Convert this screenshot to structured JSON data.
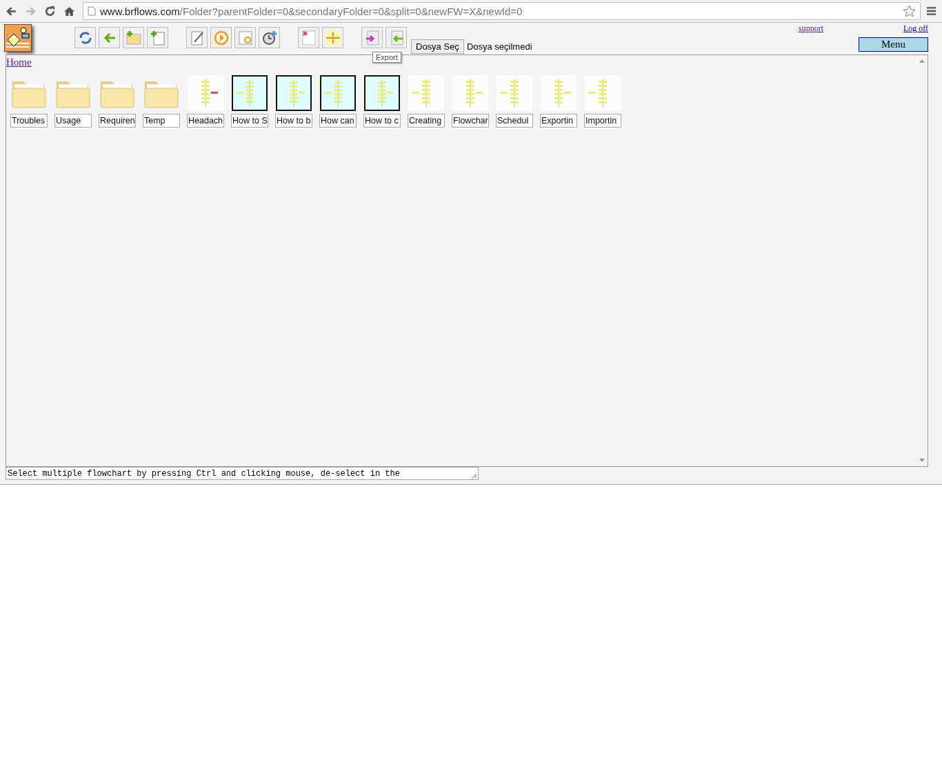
{
  "browser": {
    "url_host": "www.brflows.com",
    "url_path": "/Folder?parentFolder=0&secondaryFolder=0&split=0&newFW=X&newId=0"
  },
  "header": {
    "support_link": "support",
    "logoff_link": "Log off",
    "menu_button": "Menu",
    "file_button": "Dosya Seç",
    "file_status": "Dosya seçilmedi",
    "tooltip": "Export"
  },
  "breadcrumb": "Home",
  "items": [
    {
      "kind": "folder",
      "label": "Troubles"
    },
    {
      "kind": "folder",
      "label": "Usage"
    },
    {
      "kind": "folder",
      "label": "Requiren"
    },
    {
      "kind": "folder",
      "label": "Temp"
    },
    {
      "kind": "flowchart",
      "label": "Headach",
      "selected": false
    },
    {
      "kind": "flowchart",
      "label": "How to S",
      "selected": true
    },
    {
      "kind": "flowchart",
      "label": "How to b",
      "selected": true
    },
    {
      "kind": "flowchart",
      "label": "How can",
      "selected": true
    },
    {
      "kind": "flowchart",
      "label": "How to c",
      "selected": true
    },
    {
      "kind": "flowchart",
      "label": "Creating",
      "selected": false
    },
    {
      "kind": "flowchart",
      "label": "Flowchar",
      "selected": false
    },
    {
      "kind": "flowchart",
      "label": "Schedul",
      "selected": false
    },
    {
      "kind": "flowchart",
      "label": "Exportin",
      "selected": false
    },
    {
      "kind": "flowchart",
      "label": "Importin",
      "selected": false
    }
  ],
  "status_text": "Select multiple flowchart by pressing Ctrl and clicking mouse, de-select in the"
}
